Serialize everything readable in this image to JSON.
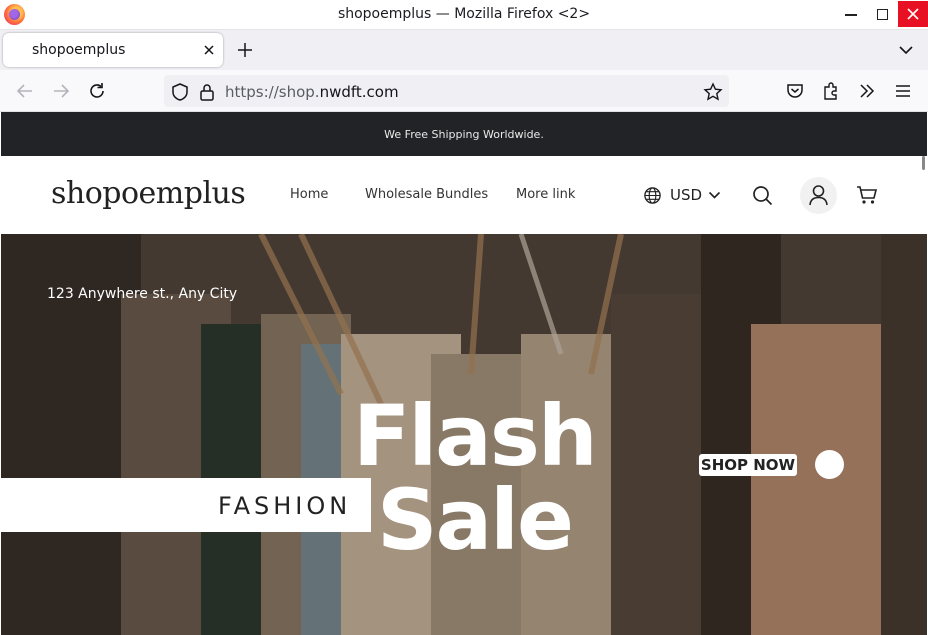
{
  "browser": {
    "window_title": "shopoemplus — Mozilla Firefox <2>",
    "tab_title": "shopoemplus",
    "url_prefix": "https://shop.",
    "url_domain": "nwdft.com",
    "icons": [
      "firefox-logo",
      "minimize-icon",
      "maximize-icon",
      "close-icon",
      "tab-close-icon",
      "new-tab-icon",
      "tab-list-icon",
      "back-icon",
      "forward-icon",
      "reload-icon",
      "shield-icon",
      "lock-icon",
      "bookmark-star-icon",
      "pocket-icon",
      "extensions-icon",
      "overflow-icon",
      "menu-icon"
    ]
  },
  "page": {
    "announcement": "We Free Shipping Worldwide.",
    "logo": "shopoemplus",
    "nav": [
      "Home",
      "Wholesale Bundles",
      "More link"
    ],
    "currency": "USD",
    "icons": [
      "globe-icon",
      "chevron-down-icon",
      "search-icon",
      "account-icon",
      "cart-icon"
    ]
  },
  "hero": {
    "address": "123 Anywhere st., Any City",
    "headline_1": "Flash",
    "headline_2": "Sale",
    "band_text": "FASHION",
    "cta": "SHOP NOW"
  },
  "colors": {
    "announcement_bg": "#222326",
    "close_button": "#e81123",
    "tab_strip": "#f0f0f4"
  }
}
